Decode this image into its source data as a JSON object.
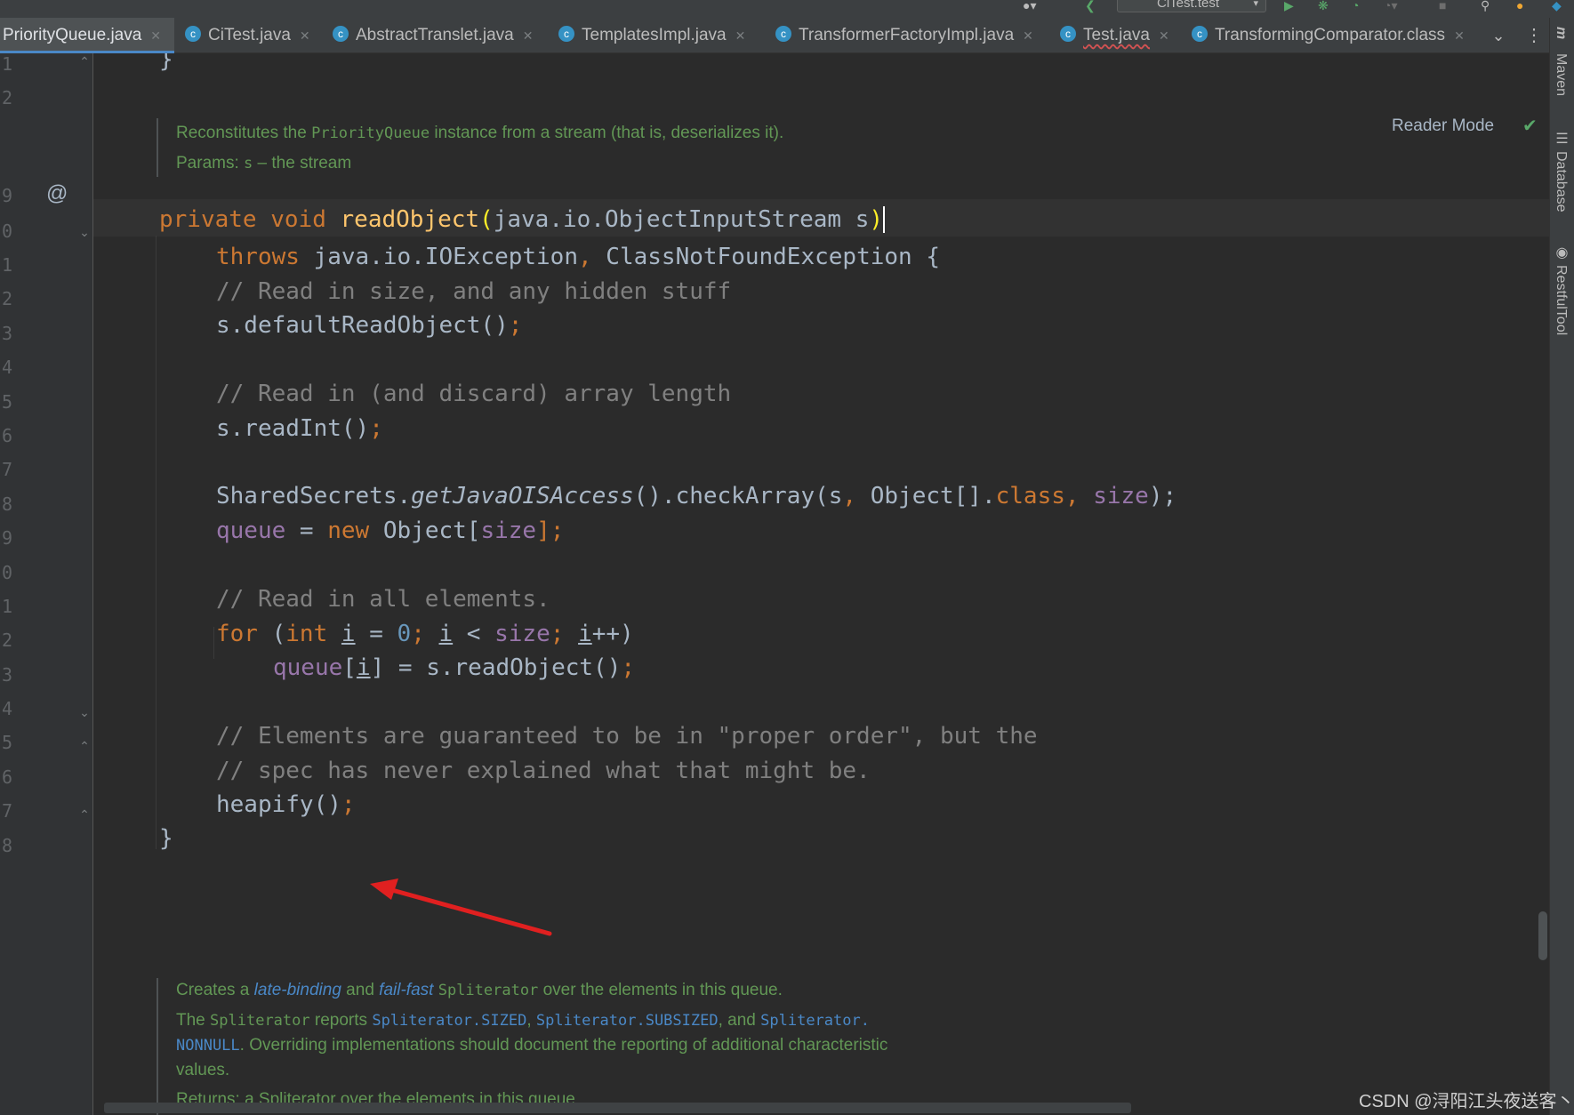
{
  "toolbar": {
    "run_config": "CiTest.test"
  },
  "tabs": [
    {
      "label": "PriorityQueue.java"
    },
    {
      "label": "CiTest.java"
    },
    {
      "label": "AbstractTranslet.java"
    },
    {
      "label": "TemplatesImpl.java"
    },
    {
      "label": "TransformerFactoryImpl.java"
    },
    {
      "label": "Test.java"
    },
    {
      "label": "TransformingComparator.class"
    }
  ],
  "right_tools": {
    "maven": "Maven",
    "database": "Database",
    "restful": "RestfulTool"
  },
  "editor": {
    "reader_mode": "Reader Mode",
    "line_numbers": [
      "1",
      "2",
      "9",
      "0",
      "1",
      "2",
      "3",
      "4",
      "5",
      "6",
      "7",
      "8",
      "9",
      "0",
      "1",
      "2",
      "3",
      "4",
      "5",
      "6",
      "7",
      "8"
    ],
    "doc1": {
      "t1": "Reconstitutes the ",
      "code1": "PriorityQueue",
      "t2": " instance from a stream (that is, deserializes it).",
      "params_label": "Params:",
      "param_name": "s",
      "param_desc": " – the stream"
    },
    "code": {
      "l1_brace": "}",
      "l9_private": "private",
      "l9_void": "void",
      "l9_name": "readObject",
      "l9_open": "(",
      "l9_args": "java.io.ObjectInputStream s",
      "l9_close": ")",
      "l10_throws": "throws",
      "l10_rest": " java.io.IOException",
      "l10_comma": ",",
      "l10_rest2": " ClassNotFoundException {",
      "l11": "// Read in size, and any hidden stuff",
      "l12_call": "s.defaultReadObject()",
      "l12_semi": ";",
      "l14": "// Read in (and discard) array length",
      "l15_call": "s.readInt()",
      "l15_semi": ";",
      "l17_a": "SharedSecrets.",
      "l17_b": "getJavaOISAccess",
      "l17_c": "().checkArray(s",
      "l17_d": ",",
      "l17_e": " Object[].",
      "l17_f": "class",
      "l17_g": ",",
      "l17_h": " size",
      "l17_i": ");",
      "l18_a": "queue",
      "l18_b": " = ",
      "l18_c": "new",
      "l18_d": " Object[",
      "l18_e": "size",
      "l18_f": "];",
      "l20": "// Read in all elements.",
      "l21_for": "for",
      "l21_a": " (",
      "l21_int": "int",
      "l21_sp": " ",
      "l21_i1": "i",
      "l21_b": " = ",
      "l21_zero": "0",
      "l21_semi1": ";",
      "l21_sp2": " ",
      "l21_i2": "i",
      "l21_lt": " < ",
      "l21_size": "size",
      "l21_semi2": ";",
      "l21_sp3": " ",
      "l21_i3": "i",
      "l21_end": "++)",
      "l22_q": "queue",
      "l22_a": "[",
      "l22_i": "i",
      "l22_b": "] = s.readObject()",
      "l22_semi": ";",
      "l24": "// Elements are guaranteed to be in \"proper order\", but the",
      "l25": "// spec has never explained what that might be.",
      "l26_call": "heapify()",
      "l26_semi": ";",
      "l27_brace": "}"
    },
    "doc2": {
      "t1": "Creates a ",
      "i1": "late-binding",
      "t2": " and ",
      "i2": "fail-fast",
      "t3": " ",
      "code1": "Spliterator",
      "t4": " over the elements in this queue.",
      "p2_t1": "The ",
      "p2_code": "Spliterator",
      "p2_t2": " reports ",
      "link1": "Spliterator.SIZED",
      "p2_c1": ", ",
      "link2": "Spliterator.SUBSIZED",
      "p2_t3": ", and ",
      "link3": "Spliterator.",
      "link4": "NONNULL",
      "p2_t4": ". Overriding implementations should document the reporting of additional characteristic",
      "p2_t5": "values.",
      "p3": "Returns: a Spliterator over the elements in this queue"
    }
  },
  "watermark": "CSDN @浔阳江头夜送客丶",
  "colors": {
    "background": "#2b2b2b",
    "keyword": "#cc7832",
    "function": "#ffc66d",
    "comment": "#808080",
    "field": "#9876aa",
    "number": "#6897bb",
    "doc": "#629755",
    "annotation_arrow": "#e02020",
    "tab_accent": "#4a88c7"
  }
}
